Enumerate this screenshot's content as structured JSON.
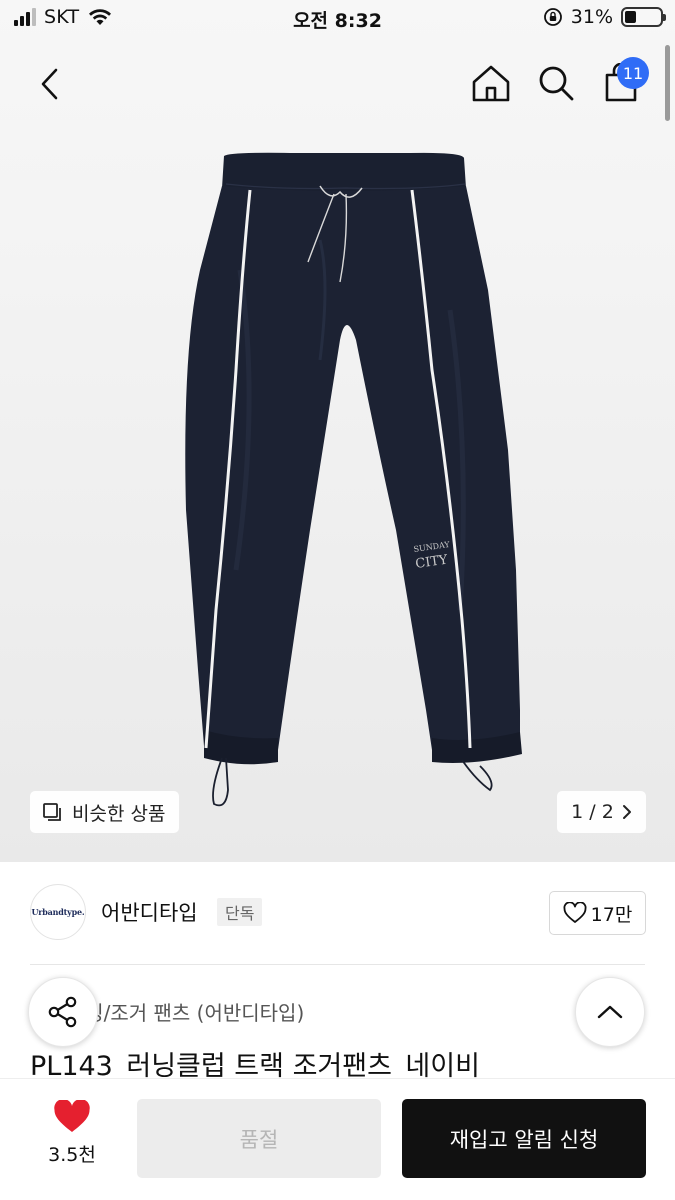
{
  "status_bar": {
    "carrier": "SKT",
    "time": "오전 8:32",
    "battery_percent": "31%",
    "battery_level": 0.31
  },
  "header": {
    "cart_count": "11"
  },
  "image": {
    "similar_label": "비슷한 상품",
    "pager": "1 / 2",
    "print_text": "SUNDAY CITY"
  },
  "brand": {
    "logo_text": "Urbandtype.",
    "name": "어반디타입",
    "tag": "단독",
    "likes": "17만"
  },
  "product": {
    "category": "트레이닝/조거 팬츠 (어반디타입)",
    "title": "PL143_러닝클럽 트랙 조거팬츠_네이비"
  },
  "bottom_bar": {
    "like_count": "3.5천",
    "soldout_label": "품절",
    "restock_label": "재입고 알림 신청"
  },
  "colors": {
    "badge": "#2f6cf6",
    "heart": "#e5202f",
    "pants": "#1c2233",
    "primary_button": "#111111"
  }
}
